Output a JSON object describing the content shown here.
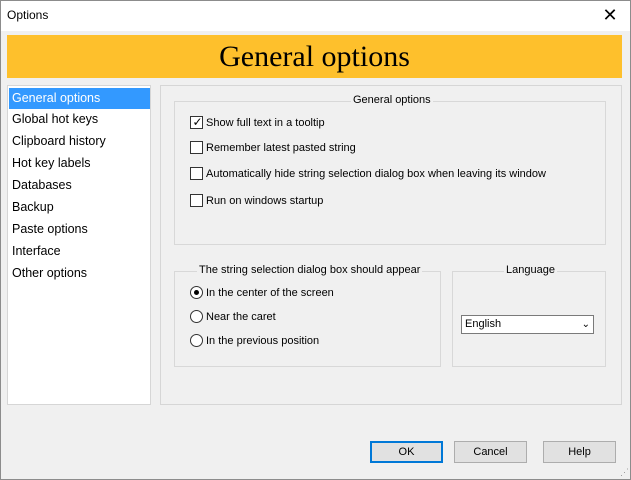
{
  "window": {
    "title": "Options",
    "close_glyph": "✕"
  },
  "banner": {
    "title": "General options",
    "color": "#fec02c"
  },
  "sidebar": {
    "items": [
      {
        "label": "General options",
        "selected": true
      },
      {
        "label": "Global hot keys"
      },
      {
        "label": "Clipboard history"
      },
      {
        "label": "Hot key labels"
      },
      {
        "label": "Databases"
      },
      {
        "label": "Backup"
      },
      {
        "label": "Paste options"
      },
      {
        "label": "Interface"
      },
      {
        "label": "Other options"
      }
    ],
    "selection_color": "#3399ff"
  },
  "general_group": {
    "title": "General options",
    "checkboxes": [
      {
        "label": "Show full text in a tooltip",
        "checked": true
      },
      {
        "label": "Remember latest pasted string",
        "checked": false
      },
      {
        "label": "Automatically hide string selection dialog box when leaving its window",
        "checked": false
      },
      {
        "label": "Run on windows startup",
        "checked": false
      }
    ]
  },
  "position_group": {
    "title": "The string selection dialog box should appear",
    "options": [
      {
        "label": "In the center of the screen",
        "selected": true
      },
      {
        "label": "Near the caret",
        "selected": false
      },
      {
        "label": "In the previous position",
        "selected": false
      }
    ]
  },
  "language_group": {
    "title": "Language",
    "selected": "English"
  },
  "buttons": {
    "ok": "OK",
    "cancel": "Cancel",
    "help": "Help"
  }
}
